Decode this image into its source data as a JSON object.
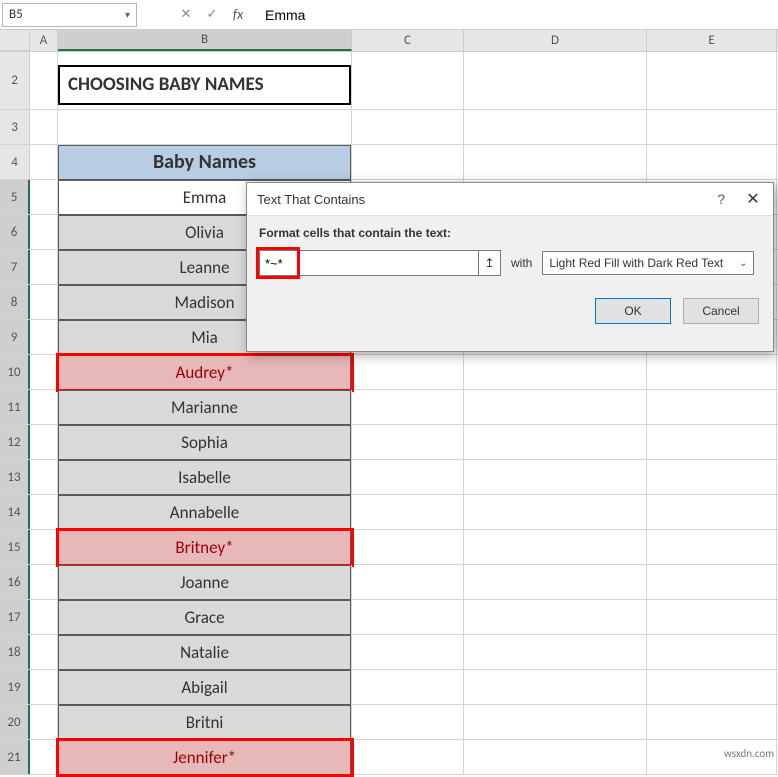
{
  "formula_bar": {
    "name_box": "B5",
    "formula": "Emma"
  },
  "columns": [
    "A",
    "B",
    "C",
    "D",
    "E"
  ],
  "title": "CHOOSING BABY NAMES",
  "table_header": "Baby Names",
  "rows": [
    {
      "num": 2,
      "type": "title"
    },
    {
      "num": 3,
      "type": "blank"
    },
    {
      "num": 4,
      "type": "header"
    },
    {
      "num": 5,
      "type": "data",
      "value": "Emma",
      "active": true,
      "cf": false,
      "ring": false
    },
    {
      "num": 6,
      "type": "data",
      "value": "Olivia",
      "active": false,
      "cf": false,
      "ring": false
    },
    {
      "num": 7,
      "type": "data",
      "value": "Leanne",
      "active": false,
      "cf": false,
      "ring": false
    },
    {
      "num": 8,
      "type": "data",
      "value": "Madison",
      "active": false,
      "cf": false,
      "ring": false
    },
    {
      "num": 9,
      "type": "data",
      "value": "Mia",
      "active": false,
      "cf": false,
      "ring": false
    },
    {
      "num": 10,
      "type": "data",
      "value": "Audrey*",
      "active": false,
      "cf": true,
      "ring": true
    },
    {
      "num": 11,
      "type": "data",
      "value": "Marianne",
      "active": false,
      "cf": false,
      "ring": false
    },
    {
      "num": 12,
      "type": "data",
      "value": "Sophia",
      "active": false,
      "cf": false,
      "ring": false
    },
    {
      "num": 13,
      "type": "data",
      "value": "Isabelle",
      "active": false,
      "cf": false,
      "ring": false
    },
    {
      "num": 14,
      "type": "data",
      "value": "Annabelle",
      "active": false,
      "cf": false,
      "ring": false
    },
    {
      "num": 15,
      "type": "data",
      "value": "Britney*",
      "active": false,
      "cf": true,
      "ring": true
    },
    {
      "num": 16,
      "type": "data",
      "value": "Joanne",
      "active": false,
      "cf": false,
      "ring": false
    },
    {
      "num": 17,
      "type": "data",
      "value": "Grace",
      "active": false,
      "cf": false,
      "ring": false
    },
    {
      "num": 18,
      "type": "data",
      "value": "Natalie",
      "active": false,
      "cf": false,
      "ring": false
    },
    {
      "num": 19,
      "type": "data",
      "value": "Abigail",
      "active": false,
      "cf": false,
      "ring": false
    },
    {
      "num": 20,
      "type": "data",
      "value": "Britni",
      "active": false,
      "cf": false,
      "ring": false
    },
    {
      "num": 21,
      "type": "data",
      "value": "Jennifer*",
      "active": false,
      "cf": true,
      "ring": true
    }
  ],
  "dialog": {
    "title": "Text That Contains",
    "label": "Format cells that contain the text:",
    "input_value": "*~*",
    "with_label": "with",
    "select_value": "Light Red Fill with Dark Red Text",
    "ok": "OK",
    "cancel": "Cancel"
  },
  "icons": {
    "dropdown": "▾",
    "cancel_x": "✕",
    "check": "✓",
    "fx": "fx",
    "range": "↥",
    "help": "?",
    "close": "✕",
    "chev": "⌄"
  },
  "watermark": "wsxdn.com"
}
